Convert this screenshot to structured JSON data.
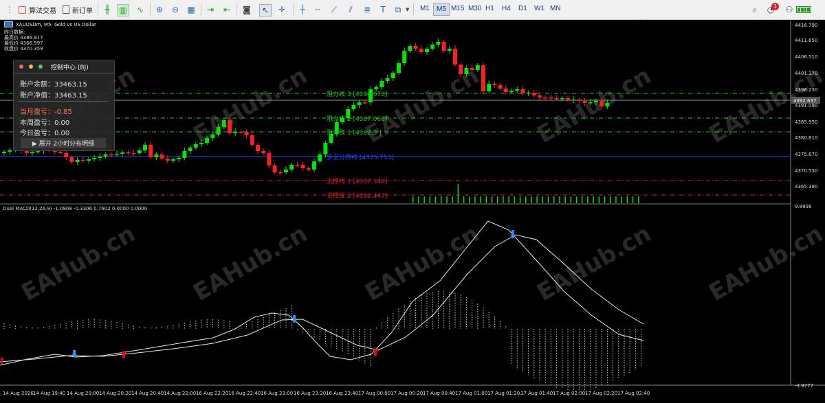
{
  "toolbar": {
    "algo_label": "算法交易",
    "new_order_label": "新订单",
    "timeframes": [
      "M1",
      "M5",
      "M15",
      "M30",
      "H1",
      "H4",
      "D1",
      "W1",
      "MN"
    ],
    "active_timeframe": "M5",
    "notification_count": "1"
  },
  "symbol_title": "XAUUSDm, M5: Gold vs US Dollar",
  "yesterday_info": {
    "header": "昨日数据:",
    "high": "最高价 4386.917",
    "low": "最低价 4366.997",
    "close": "收盘价 4370.359"
  },
  "panel": {
    "title": "控制中心 (BJ)",
    "balance": "账户余额：33463.15",
    "equity": "账户净值：33463.15",
    "month_pl_label": "当月盈亏：",
    "month_pl_value": "-0.85",
    "week_pl": "本周盈亏：0.00",
    "day_pl": "今日盈亏：0.00",
    "expand_label": "▶ 展开 2小时分布明细"
  },
  "levels": {
    "r3": "阻力线 3 [4394.678]",
    "r2": "阻力线 2 [4387.068]",
    "r1": "阻力线 1 [4382.3 ]",
    "pivot": "多空分界线 [4375.753]",
    "s1": "支撑线 1 [4367.148]",
    "s2": "支撑线 2 [4362.447]"
  },
  "price_axis": [
    "4416.790",
    "4411.650",
    "4406.510",
    "4401.370",
    "4396.230",
    "4391.090",
    "4385.950",
    "4380.810",
    "4375.670",
    "4370.530",
    "4365.390"
  ],
  "current_price": "4392.637",
  "macd": {
    "label": "Dual MACD(12,26,9) -1.0908 -0.3306 0.7602 0.0000 0.0000",
    "axis_top": "9.8956",
    "axis_bottom": "-3.9777"
  },
  "time_axis": [
    "14 Aug 2026",
    "14 Aug 19:40",
    "14 Aug 20:00",
    "14 Aug 20:20",
    "14 Aug 20:40",
    "14 Aug 22:00",
    "16 Aug 22:20",
    "16 Aug 22:40",
    "16 Aug 23:00",
    "16 Aug 23:20",
    "16 Aug 23:40",
    "17 Aug 00:00",
    "17 Aug 00:20",
    "17 Aug 00:40",
    "17 Aug 01:00",
    "17 Aug 01:20",
    "17 Aug 01:40",
    "17 Aug 02:00",
    "17 Aug 02:20",
    "17 Aug 02:40"
  ],
  "watermark": "EAHub.cn",
  "colors": {
    "bull": "#00e400",
    "bear": "#ff1f1f",
    "resistance": "#22c322",
    "support": "#e02020",
    "pivot": "#2a4bff"
  }
}
